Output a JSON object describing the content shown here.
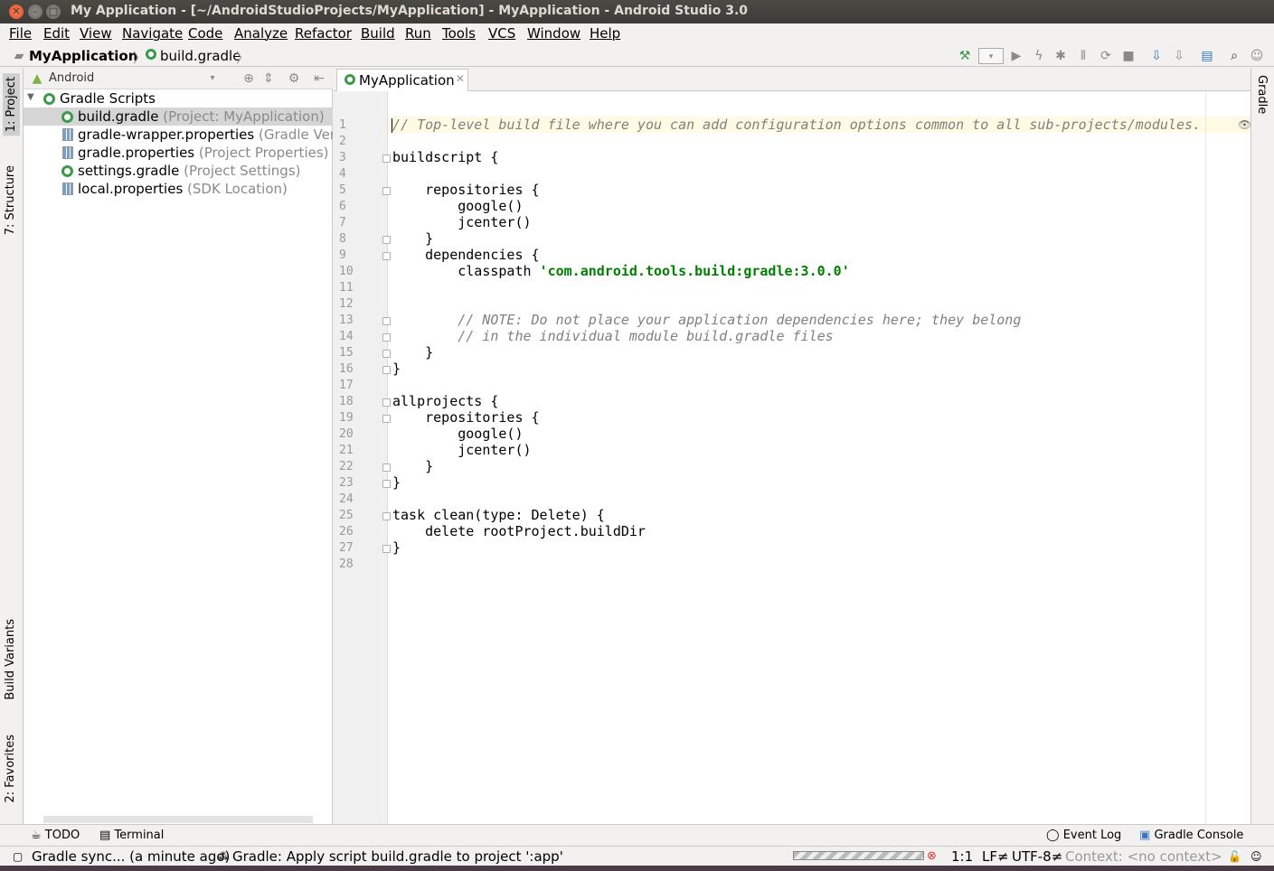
{
  "window": {
    "title": "My Application - [~/AndroidStudioProjects/MyApplication] - MyApplication - Android Studio 3.0"
  },
  "menu": [
    "File",
    "Edit",
    "View",
    "Navigate",
    "Code",
    "Analyze",
    "Refactor",
    "Build",
    "Run",
    "Tools",
    "VCS",
    "Window",
    "Help"
  ],
  "breadcrumb": {
    "project": "MyApplication",
    "file": "build.gradle"
  },
  "left_tabs": {
    "project": "1: Project",
    "structure": "7: Structure",
    "build_variants": "Build Variants",
    "favorites": "2: Favorites"
  },
  "right_tabs": {
    "gradle": "Gradle"
  },
  "project_panel": {
    "view": "Android",
    "tree": [
      {
        "name": "Gradle Scripts",
        "hint": "",
        "icon": "gradle-icon"
      },
      {
        "name": "build.gradle",
        "hint": "(Project: MyApplication)",
        "icon": "gradle-icon"
      },
      {
        "name": "gradle-wrapper.properties",
        "hint": "(Gradle Versi",
        "icon": "properties-icon"
      },
      {
        "name": "gradle.properties",
        "hint": "(Project Properties)",
        "icon": "properties-icon"
      },
      {
        "name": "settings.gradle",
        "hint": "(Project Settings)",
        "icon": "gradle-icon"
      },
      {
        "name": "local.properties",
        "hint": "(SDK Location)",
        "icon": "properties-icon"
      }
    ]
  },
  "editor": {
    "tab": "MyApplication",
    "lines": [
      "// Top-level build file where you can add configuration options common to all sub-projects/modules.",
      "",
      "buildscript {",
      "",
      "    repositories {",
      "        google()",
      "        jcenter()",
      "    }",
      "    dependencies {",
      "        classpath 'com.android.tools.build:gradle:3.0.0'",
      "",
      "",
      "        // NOTE: Do not place your application dependencies here; they belong",
      "        // in the individual module build.gradle files",
      "    }",
      "}",
      "",
      "allprojects {",
      "    repositories {",
      "        google()",
      "        jcenter()",
      "    }",
      "}",
      "",
      "task clean(type: Delete) {",
      "    delete rootProject.buildDir",
      "}",
      ""
    ]
  },
  "bottom_tabs": {
    "todo": "TODO",
    "terminal": "Terminal",
    "event_log": "Event Log",
    "gradle_console": "Gradle Console"
  },
  "status": {
    "sync": "Gradle sync... (a minute ago)",
    "message": "Gradle: Apply script build.gradle to project ':app'",
    "position": "1:1",
    "line_sep": "LF≠",
    "encoding": "UTF-8≠",
    "context": "Context: <no context>"
  },
  "colors": {
    "string": "#008000",
    "comment": "#808080",
    "gradle_icon": "#3a9a4a",
    "current_line": "#fffae3"
  }
}
